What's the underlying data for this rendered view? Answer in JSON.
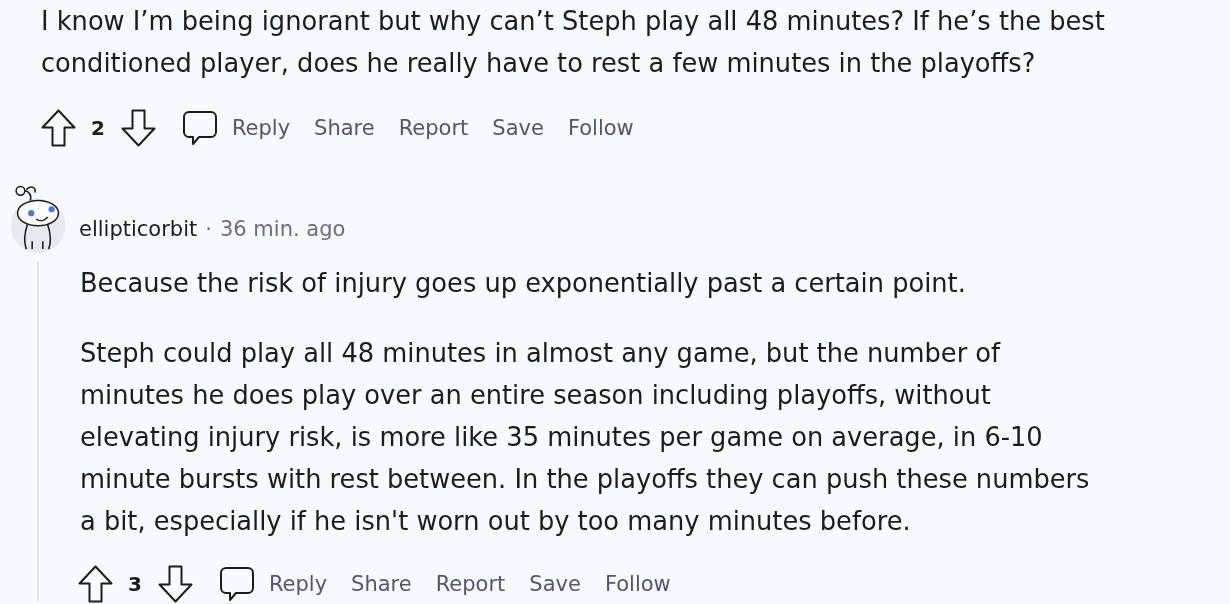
{
  "parent_comment": {
    "body": "I know I’m being ignorant but why can’t Steph play all 48 minutes? If he’s the best conditioned player, does he really have to rest a few minutes in the playoffs?",
    "votes": "2",
    "actions": [
      {
        "label": "Reply",
        "kind": "comment"
      },
      {
        "label": "Share",
        "kind": "text"
      },
      {
        "label": "Report",
        "kind": "text"
      },
      {
        "label": "Save",
        "kind": "text"
      },
      {
        "label": "Follow",
        "kind": "text"
      }
    ]
  },
  "reply": {
    "author": "ellipticorbit",
    "separator": "·",
    "time": "36 min. ago",
    "paragraphs": [
      "Because the risk of injury goes up exponentially past a certain point.",
      "Steph could play all 48 minutes in almost any game, but the number of minutes he does play over an entire season including playoffs, without elevating injury risk, is more like 35 minutes per game on average, in 6-10 minute bursts with rest between. In the playoffs they can push these numbers a bit, especially if he isn't worn out by too many minutes before."
    ],
    "votes": "3",
    "actions": [
      {
        "label": "Reply",
        "kind": "comment"
      },
      {
        "label": "Share",
        "kind": "text"
      },
      {
        "label": "Report",
        "kind": "text"
      },
      {
        "label": "Save",
        "kind": "text"
      },
      {
        "label": "Follow",
        "kind": "text"
      }
    ]
  }
}
